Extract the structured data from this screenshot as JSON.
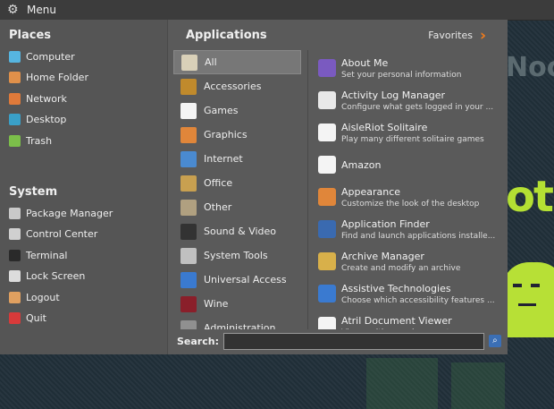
{
  "topbar": {
    "title": "Menu",
    "icon": "gear-icon"
  },
  "places": {
    "title": "Places",
    "items": [
      {
        "label": "Computer",
        "icon": "computer-icon",
        "color": "#56b5e0"
      },
      {
        "label": "Home Folder",
        "icon": "home-folder-icon",
        "color": "#e0904a"
      },
      {
        "label": "Network",
        "icon": "network-icon",
        "color": "#e07a3a"
      },
      {
        "label": "Desktop",
        "icon": "desktop-icon",
        "color": "#3aa0c8"
      },
      {
        "label": "Trash",
        "icon": "trash-icon",
        "color": "#7cbf4a"
      }
    ]
  },
  "system": {
    "title": "System",
    "items": [
      {
        "label": "Package Manager",
        "icon": "package-manager-icon",
        "color": "#c9c9c9"
      },
      {
        "label": "Control Center",
        "icon": "control-center-icon",
        "color": "#d0d0d0"
      },
      {
        "label": "Terminal",
        "icon": "terminal-icon",
        "color": "#2a2a2a"
      },
      {
        "label": "Lock Screen",
        "icon": "lock-screen-icon",
        "color": "#dcdcdc"
      },
      {
        "label": "Logout",
        "icon": "logout-icon",
        "color": "#e0a060"
      },
      {
        "label": "Quit",
        "icon": "quit-icon",
        "color": "#d83a3a"
      }
    ]
  },
  "applications": {
    "title": "Applications",
    "favorites_label": "Favorites",
    "categories": [
      {
        "label": "All",
        "icon": "all-icon",
        "color": "#d9d0b8"
      },
      {
        "label": "Accessories",
        "icon": "accessories-icon",
        "color": "#c08a2c"
      },
      {
        "label": "Games",
        "icon": "games-icon",
        "color": "#f4f4f4"
      },
      {
        "label": "Graphics",
        "icon": "graphics-icon",
        "color": "#e0863a"
      },
      {
        "label": "Internet",
        "icon": "internet-icon",
        "color": "#4a8ad0"
      },
      {
        "label": "Office",
        "icon": "office-icon",
        "color": "#c8a050"
      },
      {
        "label": "Other",
        "icon": "other-icon",
        "color": "#b0a080"
      },
      {
        "label": "Sound & Video",
        "icon": "sound-video-icon",
        "color": "#333333"
      },
      {
        "label": "System Tools",
        "icon": "system-tools-icon",
        "color": "#c0c0c0"
      },
      {
        "label": "Universal Access",
        "icon": "universal-access-icon",
        "color": "#3a7ad0"
      },
      {
        "label": "Wine",
        "icon": "wine-icon",
        "color": "#8a1f2a"
      },
      {
        "label": "Administration",
        "icon": "administration-icon",
        "color": "#909090"
      }
    ],
    "apps": [
      {
        "name": "About Me",
        "desc": "Set your personal information",
        "icon": "about-me-icon",
        "color": "#7a5ac0"
      },
      {
        "name": "Activity Log Manager",
        "desc": "Configure what gets logged in your ...",
        "icon": "activity-log-icon",
        "color": "#e8e8e8"
      },
      {
        "name": "AisleRiot Solitaire",
        "desc": "Play many different solitaire games",
        "icon": "solitaire-icon",
        "color": "#f4f4f4"
      },
      {
        "name": "Amazon",
        "desc": "",
        "icon": "amazon-icon",
        "color": "#f4f4f4"
      },
      {
        "name": "Appearance",
        "desc": "Customize the look of the desktop",
        "icon": "appearance-icon",
        "color": "#e0863a"
      },
      {
        "name": "Application Finder",
        "desc": "Find and launch applications installe...",
        "icon": "application-finder-icon",
        "color": "#3a6ab0"
      },
      {
        "name": "Archive Manager",
        "desc": "Create and modify an archive",
        "icon": "archive-manager-icon",
        "color": "#d8b04a"
      },
      {
        "name": "Assistive Technologies",
        "desc": "Choose which accessibility features ...",
        "icon": "assistive-tech-icon",
        "color": "#3a7ad0"
      },
      {
        "name": "Atril Document Viewer",
        "desc": "View multi-page documents",
        "icon": "atril-icon",
        "color": "#f4f4f4"
      }
    ]
  },
  "search": {
    "label": "Search:",
    "value": "",
    "placeholder": ""
  }
}
